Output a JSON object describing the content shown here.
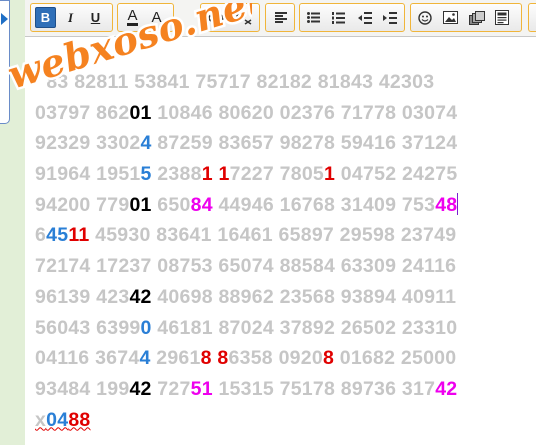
{
  "toolbar": {
    "bold_label": "B",
    "italic_label": "I",
    "underline_label": "U",
    "text_color_label": "A",
    "bg_color_label": "A",
    "buttons": [
      "bold-button",
      "italic-button",
      "underline-button",
      "text-color-button",
      "background-color-button",
      "link-button",
      "unlink-button",
      "align-left-button",
      "bullet-list-button",
      "numbered-list-button",
      "outdent-button",
      "indent-button",
      "emoticon-button",
      "image-button",
      "media-button",
      "source-button"
    ]
  },
  "watermark": {
    "text": "webxoso.net"
  },
  "lines": [
    [
      {
        "t": "  83 82811 53841 75717 82182 81843 42303",
        "c": "gray"
      }
    ],
    [
      {
        "t": "03797 862",
        "c": "gray"
      },
      {
        "t": "01",
        "c": "black"
      },
      {
        "t": " 10846 80620 02376 71778 03074",
        "c": "gray"
      }
    ],
    [
      {
        "t": "92329 3302",
        "c": "gray"
      },
      {
        "t": "4",
        "c": "blue"
      },
      {
        "t": " 87259 83657 98278 59416 37124",
        "c": "gray"
      }
    ],
    [
      {
        "t": "91964 1951",
        "c": "gray"
      },
      {
        "t": "5",
        "c": "blue"
      },
      {
        "t": " 2388",
        "c": "gray"
      },
      {
        "t": "1",
        "c": "red"
      },
      {
        "t": " ",
        "c": "gray"
      },
      {
        "t": "1",
        "c": "red"
      },
      {
        "t": "7227 7805",
        "c": "gray"
      },
      {
        "t": "1",
        "c": "red"
      },
      {
        "t": " 04752 24275",
        "c": "gray"
      }
    ],
    [
      {
        "t": "94200 779",
        "c": "gray"
      },
      {
        "t": "01",
        "c": "black"
      },
      {
        "t": " 650",
        "c": "gray"
      },
      {
        "t": "84",
        "c": "mag"
      },
      {
        "t": " 44946 16768 31409 753",
        "c": "gray"
      },
      {
        "t": "48",
        "c": "mag"
      }
    ],
    [
      {
        "t": "6",
        "c": "gray"
      },
      {
        "t": "45",
        "c": "blue"
      },
      {
        "t": "11",
        "c": "red"
      },
      {
        "t": " 45930 83641 16461 65897 29598 23749",
        "c": "gray"
      }
    ],
    [
      {
        "t": "72174 17237 08753 65074 88584 63309 24116",
        "c": "gray"
      }
    ],
    [
      {
        "t": "96139 423",
        "c": "gray"
      },
      {
        "t": "42",
        "c": "black"
      },
      {
        "t": " 40698 88962 23568 93894 40911",
        "c": "gray"
      }
    ],
    [
      {
        "t": "56043 6399",
        "c": "gray"
      },
      {
        "t": "0",
        "c": "blue"
      },
      {
        "t": " 46181 87024 37892 26502 23310",
        "c": "gray"
      }
    ],
    [
      {
        "t": "04116 3674",
        "c": "gray"
      },
      {
        "t": "4",
        "c": "blue"
      },
      {
        "t": " 2961",
        "c": "gray"
      },
      {
        "t": "8",
        "c": "red"
      },
      {
        "t": " ",
        "c": "gray"
      },
      {
        "t": "8",
        "c": "red"
      },
      {
        "t": "6358 0920",
        "c": "gray"
      },
      {
        "t": "8",
        "c": "red"
      },
      {
        "t": " 01682 25000",
        "c": "gray"
      }
    ],
    [
      {
        "t": "93484 199",
        "c": "gray"
      },
      {
        "t": "42",
        "c": "black"
      },
      {
        "t": " 727",
        "c": "gray"
      },
      {
        "t": "51",
        "c": "mag"
      },
      {
        "t": " 15315 75178 89736 317",
        "c": "gray"
      },
      {
        "t": "42",
        "c": "mag"
      }
    ],
    [
      {
        "t": "x",
        "c": "gray"
      },
      {
        "t": "04",
        "c": "blue"
      },
      {
        "t": "88",
        "c": "red"
      }
    ]
  ],
  "caret_line": 4,
  "squiggle_line": 11,
  "colors": {
    "gray": "#c6c6c6",
    "black": "#000000",
    "blue": "#2a7fd6",
    "red": "#e00000",
    "magenta": "#ee00ee",
    "watermark_fill": "#f58220",
    "watermark_stroke": "#ffffff",
    "toolbar_border": "#f0b53a",
    "active_button": "#2f6fb8"
  }
}
